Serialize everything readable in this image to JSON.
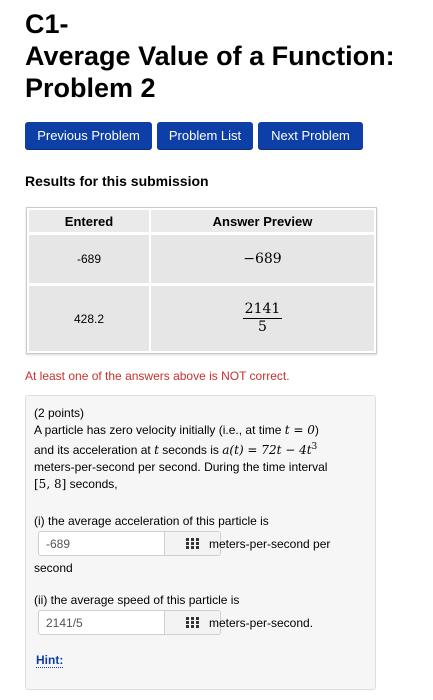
{
  "page": {
    "title_line1": "C1-",
    "title_line2": "Average Value of a Function:",
    "title_line3": "Problem 2"
  },
  "nav": {
    "previous": "Previous Problem",
    "list": "Problem List",
    "next": "Next Problem"
  },
  "results": {
    "heading": "Results for this submission",
    "columns": [
      "Entered",
      "Answer Preview"
    ],
    "rows": [
      {
        "entered": "-689",
        "preview": "−689"
      },
      {
        "entered": "428.2",
        "preview_num": "2141",
        "preview_den": "5"
      }
    ],
    "warning": "At least one of the answers above is NOT correct."
  },
  "problem": {
    "points": "(2 points)",
    "stmt_a": "A particle has zero velocity initially (i.e., at time ",
    "stmt_a_math": "t = 0",
    "stmt_a_end": ")",
    "stmt_b": "and its acceleration at ",
    "stmt_b_t": "t",
    "stmt_b_mid": " seconds is ",
    "stmt_b_math": "a(t) = 72t − 4t",
    "stmt_b_exp": "3",
    "stmt_c": "meters-per-second per second. During the time interval",
    "stmt_d_math": "[5, 8]",
    "stmt_d": " seconds,",
    "part1_label": "(i) the average acceleration of this particle is",
    "part1_value": "-689",
    "part1_unit": "meters-per-second per",
    "part1_unit2": "second",
    "part2_label": "(ii) the average speed of this particle is",
    "part2_value": "2141/5",
    "part2_unit": "meters-per-second.",
    "hint": "Hint:"
  },
  "icons": {
    "equation_editor": "grid-icon"
  },
  "colors": {
    "button": "#0d3fa7",
    "warning": "#c9302c"
  }
}
